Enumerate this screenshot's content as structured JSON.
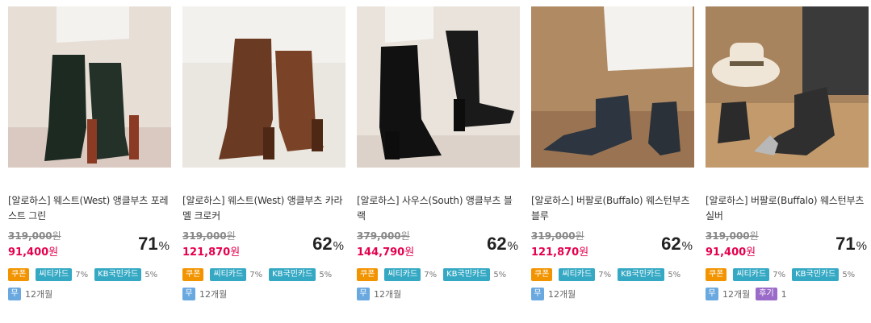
{
  "products": [
    {
      "title": "[알로하스] 웨스트(West) 앵클부츠 포레스트 그린",
      "original_price": "319,000",
      "sale_price": "91,400",
      "currency": "원",
      "discount_rate": "71",
      "discount_unit": "%",
      "coupon_label": "쿠폰",
      "card1_label": "씨티카드",
      "card1_rate": "7%",
      "card2_label": "KB국민카드",
      "card2_rate": "5%",
      "installment_label": "무",
      "installment_months": "12개월"
    },
    {
      "title": "[알로하스] 웨스트(West) 앵클부츠 카라멜 크로커",
      "original_price": "319,000",
      "sale_price": "121,870",
      "currency": "원",
      "discount_rate": "62",
      "discount_unit": "%",
      "coupon_label": "쿠폰",
      "card1_label": "씨티카드",
      "card1_rate": "7%",
      "card2_label": "KB국민카드",
      "card2_rate": "5%",
      "installment_label": "무",
      "installment_months": "12개월"
    },
    {
      "title": "[알로하스] 사우스(South) 앵클부츠 블랙",
      "original_price": "379,000",
      "sale_price": "144,790",
      "currency": "원",
      "discount_rate": "62",
      "discount_unit": "%",
      "coupon_label": "쿠폰",
      "card1_label": "씨티카드",
      "card1_rate": "7%",
      "card2_label": "KB국민카드",
      "card2_rate": "5%",
      "installment_label": "무",
      "installment_months": "12개월"
    },
    {
      "title": "[알로하스] 버팔로(Buffalo) 웨스턴부츠 블루",
      "original_price": "319,000",
      "sale_price": "121,870",
      "currency": "원",
      "discount_rate": "62",
      "discount_unit": "%",
      "coupon_label": "쿠폰",
      "card1_label": "씨티카드",
      "card1_rate": "7%",
      "card2_label": "KB국민카드",
      "card2_rate": "5%",
      "installment_label": "무",
      "installment_months": "12개월"
    },
    {
      "title": "[알로하스] 버팔로(Buffalo) 웨스턴부츠 실버",
      "original_price": "319,000",
      "sale_price": "91,400",
      "currency": "원",
      "discount_rate": "71",
      "discount_unit": "%",
      "coupon_label": "쿠폰",
      "card1_label": "씨티카드",
      "card1_rate": "7%",
      "card2_label": "KB국민카드",
      "card2_rate": "5%",
      "installment_label": "무",
      "installment_months": "12개월",
      "review_label": "후기",
      "review_count": "1"
    }
  ],
  "colors": {
    "sale_price": "#e5004f",
    "coupon_tag": "#f29400",
    "card_tag": "#35a9c4",
    "installment_tag": "#6aa8e0",
    "review_tag": "#9b6bc9"
  }
}
